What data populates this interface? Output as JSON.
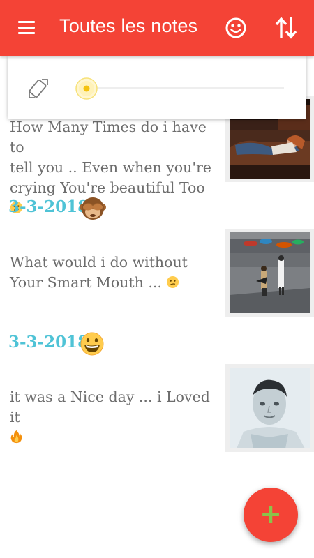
{
  "appbar": {
    "title": "Toutes les notes",
    "menu_icon": "hamburger-menu-icon",
    "mood_icon": "smiley-face-icon",
    "sort_icon": "sort-arrows-icon",
    "color": "#f44336"
  },
  "brightness": {
    "auto_icon": "auto-rotate-icon",
    "level": 0
  },
  "notes": [
    {
      "date": "",
      "text_line1": "How Many Times do i have to",
      "text_line2": "tell you .. Even when you're",
      "text_line3": "crying You're beautiful Too",
      "emoji": "confused-face",
      "image": "woman-on-couch-photo"
    },
    {
      "date": "3-3-2018",
      "date_emoji": "see-no-evil-monkey",
      "text_line1": "What would i do without",
      "text_line2": "Your Smart Mouth ...",
      "emoji": "confused-face",
      "image": "people-in-rain-photo"
    },
    {
      "date": "3-3-2018",
      "date_emoji": "grinning-face",
      "text_line1": "it was a Nice day ... i Loved it",
      "emoji": "fire",
      "image": "man-portrait-photo"
    }
  ],
  "fab": {
    "label": "+",
    "color": "#f44336",
    "icon_color": "#8bc34a"
  },
  "colors": {
    "date": "#4fc3d6",
    "note_text": "#6d6d6d"
  }
}
